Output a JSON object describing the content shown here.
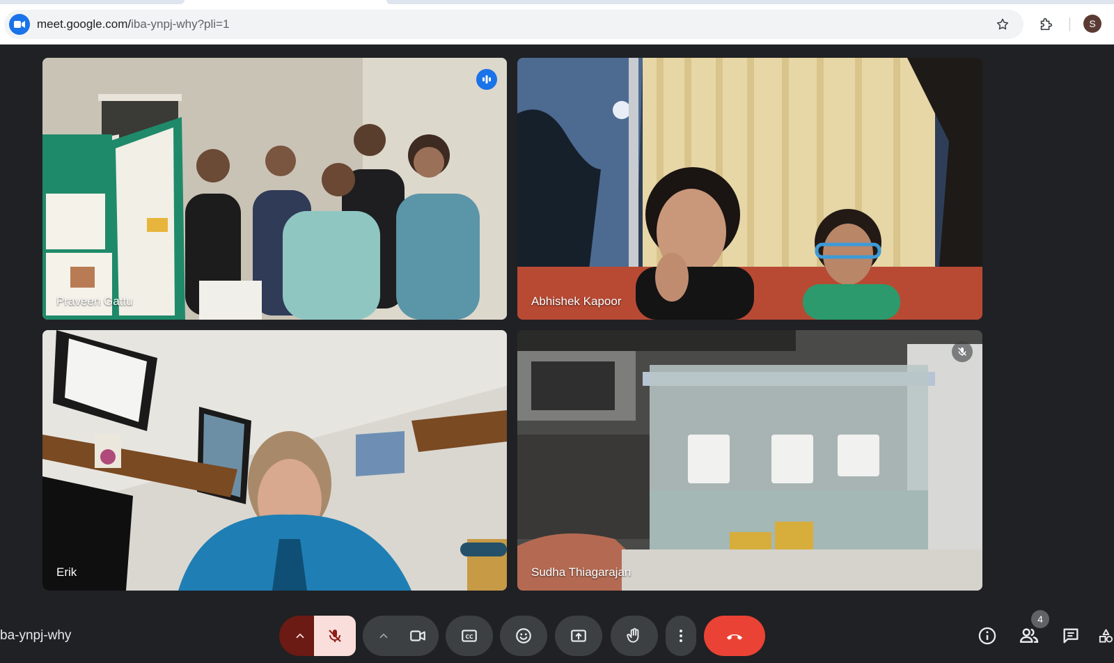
{
  "browser": {
    "url_host": "meet.google.com/",
    "url_path": "iba-ynpj-why?pli=1",
    "profile_initial": "S"
  },
  "participants": [
    {
      "name": "Praveen Gattu",
      "state": "speaking"
    },
    {
      "name": "Abhishek Kapoor",
      "state": "normal"
    },
    {
      "name": "Erik",
      "state": "normal"
    },
    {
      "name": "Sudha Thiagarajan",
      "state": "muted"
    }
  ],
  "bottom_bar": {
    "meeting_code": "ba-ynpj-why",
    "participant_count": "4"
  },
  "colors": {
    "background": "#202124",
    "speaking_outline": "#8ab4f8",
    "end_call": "#ea4335",
    "mic_muted_bg": "#f9dedc",
    "brand_blue": "#1a73e8"
  }
}
